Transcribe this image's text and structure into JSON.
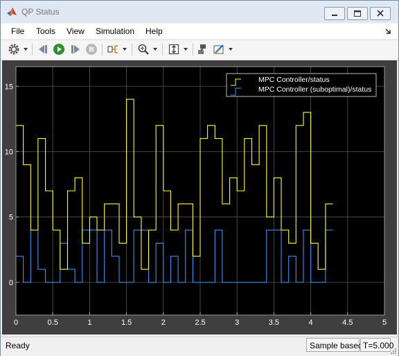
{
  "window": {
    "title": "QP Status"
  },
  "menu": {
    "items": [
      "File",
      "Tools",
      "View",
      "Simulation",
      "Help"
    ]
  },
  "toolbar": {
    "icons": [
      "gear-icon",
      "step-back-icon",
      "run-icon",
      "step-forward-icon",
      "stop-icon",
      "signal-select-icon",
      "zoom-icon",
      "autoscale-icon",
      "highlight-block-icon",
      "style-icon"
    ]
  },
  "status": {
    "state": "Ready",
    "mode": "Sample based",
    "time": "T=5.000"
  },
  "colors": {
    "plot_bg": "#000000",
    "panel_bg": "#3f3f3f",
    "series1": "#ffff33",
    "series2": "#3d8ff5",
    "grid": "#555555",
    "axis_text": "#ffffff"
  },
  "chart_data": {
    "type": "line",
    "step": true,
    "xlim": [
      0,
      5
    ],
    "ylim": [
      -2.5,
      16.5
    ],
    "xticks": [
      0,
      0.5,
      1,
      1.5,
      2,
      2.5,
      3,
      3.5,
      4,
      4.5,
      5
    ],
    "xtick_labels": [
      "0",
      "0.5",
      "1",
      "1.5",
      "2",
      "2.5",
      "3",
      "3.5",
      "4",
      "4.5",
      "5"
    ],
    "yticks": [
      0,
      5,
      10,
      15
    ],
    "ytick_labels": [
      "0",
      "5",
      "10",
      "15"
    ],
    "grid": true,
    "legend_position": "top-right",
    "dt": 0.1,
    "series": [
      {
        "name": "MPC Controller/status",
        "color": "#ffff33",
        "values": [
          12,
          9,
          4,
          11,
          7,
          4,
          1,
          7,
          8,
          3,
          5,
          4,
          6,
          6,
          3,
          14,
          5,
          1,
          4,
          12,
          7,
          4,
          6,
          6,
          2,
          11,
          12,
          11,
          6,
          8,
          7,
          11,
          9,
          12,
          5,
          8,
          4,
          3,
          12,
          13,
          3,
          1,
          6
        ]
      },
      {
        "name": "MPC Controller (suboptimal)/status",
        "color": "#3d8ff5",
        "values": [
          2,
          0,
          4,
          1,
          0,
          0,
          3,
          1,
          0,
          4,
          4,
          0,
          4,
          2,
          0,
          0,
          4,
          4,
          0,
          3,
          0,
          2,
          0,
          4,
          0,
          0,
          0,
          4,
          0,
          0,
          0,
          0,
          0,
          0,
          4,
          4,
          0,
          2,
          0,
          4,
          0,
          0,
          4
        ]
      }
    ]
  }
}
